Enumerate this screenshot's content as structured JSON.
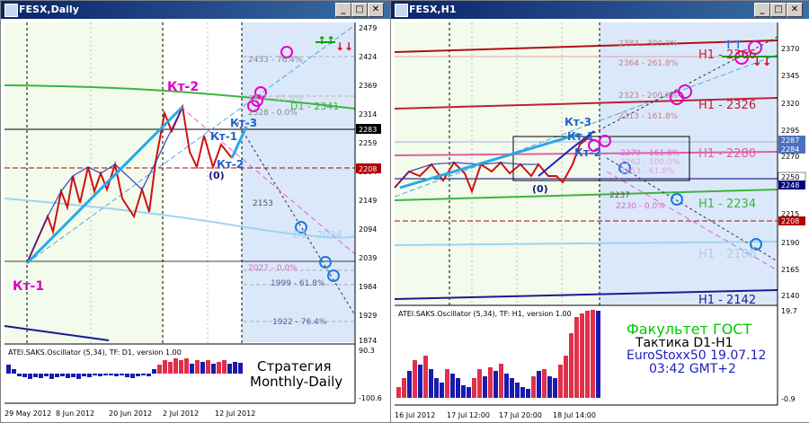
{
  "left_window": {
    "title": "FESX,Daily",
    "price_ticks": [
      "2479",
      "2424",
      "2369",
      "2314",
      "2259",
      "2204",
      "2149",
      "2094",
      "2039",
      "1984",
      "1929",
      "1874"
    ],
    "price_tags": {
      "current": "2283",
      "red": "2208"
    },
    "labels": {
      "kt1": "Кт-1",
      "kt2": "Кт-2",
      "kt3": "Кт-3",
      "kt1b": "Кт-1",
      "kt2b": "Кт-2",
      "zero": "(0)"
    },
    "fib_labels": [
      "2433 - 76.4%",
      "2371 - 61.8%",
      "2328 - 0.0%",
      "2027 - 0.0%",
      "1999 - 61.8%",
      "1922 - 76.4%"
    ],
    "level_labels": {
      "d1_upper": "D1 - 2341",
      "d1_lower": "D1 - 2094",
      "level_2153": "2153"
    },
    "osc_title": "ATEI.SAKS.Oscillator (5,34), TF: D1, version 1.00",
    "osc_ticks": [
      "90.3",
      "-100.6"
    ],
    "strategy_text": [
      "Стратегия",
      "Monthly-Daily"
    ],
    "date_ticks": [
      "29 May 2012",
      "8 Jun 2012",
      "20 Jun 2012",
      "2 Jul 2012",
      "12 Jul 2012"
    ]
  },
  "right_window": {
    "title": "FESX,H1",
    "price_ticks": [
      "2370",
      "2345",
      "2320",
      "2295",
      "2270",
      "2245",
      "2215",
      "2190",
      "2165",
      "2140"
    ],
    "price_tags": {
      "blue1": "2287",
      "blue2": "2284",
      "white": "2250",
      "navy": "2248",
      "red": "2208"
    },
    "fib_labels": [
      "2383 - 300.0%",
      "2364 - 261.8%",
      "2323 - 200.0%",
      "2313 - 161.8%",
      "2279 - 161.8%",
      "2262 - 100.0%",
      "2253 - 61.8%",
      "2237",
      "2230 - 0.0%"
    ],
    "level_labels": {
      "h1_2366": "H1 - 2366",
      "h1_2326": "H1 - 2326",
      "h1_2280": "H1 - 2280",
      "h1_2234": "H1 - 2234",
      "h1_2186": "H1 - 2186",
      "h1_2142": "H1 - 2142"
    },
    "labels": {
      "kt3": "Кт-3",
      "kt1": "Кт-1",
      "kt2": "Кт-2",
      "zero": "(0)"
    },
    "osc_title": "ATEI.SAKS.Oscillator (5,34), TF: H1, version 1.00",
    "osc_ticks": [
      "19.7",
      "-0.9"
    ],
    "info_text": [
      "Факультет ГОСТ",
      "Тактика D1-H1",
      "EuroStoxx50 19.07.12",
      "03:42 GMT+2"
    ],
    "date_ticks": [
      "16 Jul 2012",
      "17 Jul 12:00",
      "17 Jul 20:00",
      "18 Jul 14:00"
    ]
  },
  "colors": {
    "accent_pink": "#e000c8",
    "blue_label": "#1e64c8",
    "red_label": "#e00000",
    "zz_red": "#e00000",
    "zz_blue": "#2020c0",
    "cyan": "#20a0e0",
    "green": "#00a000"
  }
}
